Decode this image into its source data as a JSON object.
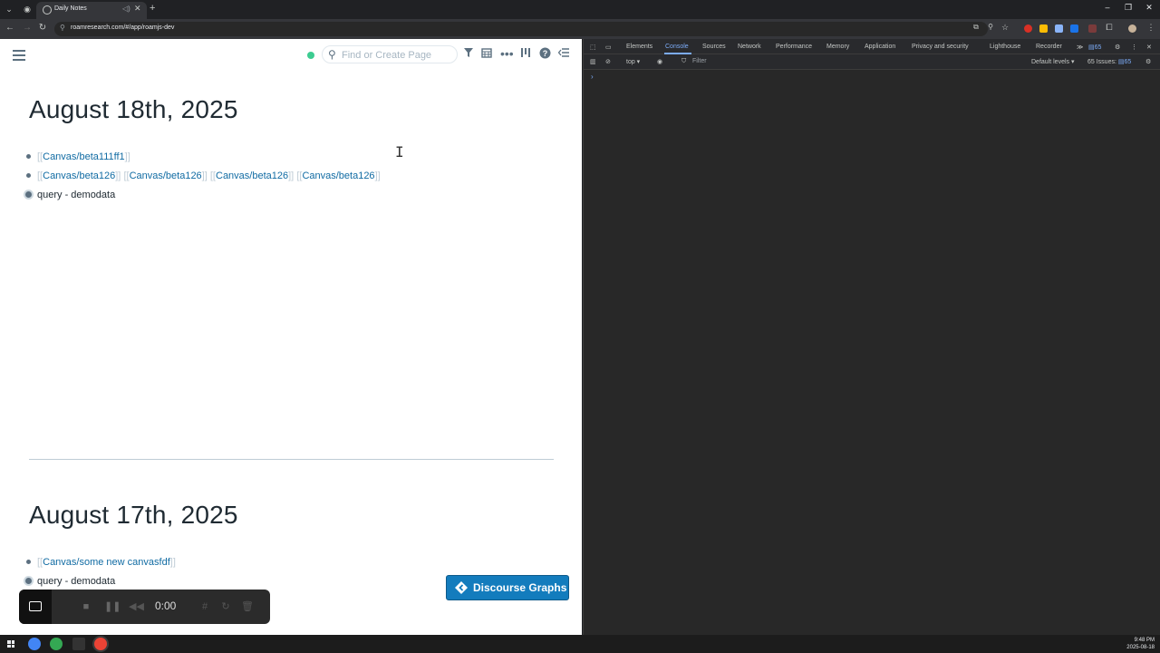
{
  "browser": {
    "tab_title": "Daily Notes",
    "url": "roamresearch.com/#/app/roamjs-dev"
  },
  "roam": {
    "search_placeholder": "Find or Create Page",
    "pages": [
      {
        "title": "August 18th, 2025",
        "blocks": [
          {
            "type": "links",
            "links": [
              "Canvas/beta111ff1"
            ]
          },
          {
            "type": "links",
            "links": [
              "Canvas/beta126",
              "Canvas/beta126",
              "Canvas/beta126",
              "Canvas/beta126"
            ]
          },
          {
            "type": "text",
            "text": "query - demodata"
          }
        ]
      },
      {
        "title": "August 17th, 2025",
        "blocks": [
          {
            "type": "links",
            "links": [
              "Canvas/some new canvasfdf"
            ]
          },
          {
            "type": "text",
            "text": "query - demodata"
          }
        ]
      }
    ],
    "discourse_button": "Discourse Graphs",
    "bracket_open": "[[",
    "bracket_close": "]]"
  },
  "recorder": {
    "time": "0:00"
  },
  "devtools": {
    "tabs": [
      "Elements",
      "Console",
      "Sources",
      "Network",
      "Performance",
      "Memory",
      "Application",
      "Privacy and security",
      "Lighthouse",
      "Recorder"
    ],
    "active_tab": "Console",
    "issue_badge_count": "65",
    "context": "top",
    "filter_placeholder": "Filter",
    "levels": "Default levels",
    "issues_label": "65 Issues:",
    "issues_count": "65"
  },
  "taskbar": {
    "time": "9:48 PM",
    "date": "2025-08-18"
  }
}
